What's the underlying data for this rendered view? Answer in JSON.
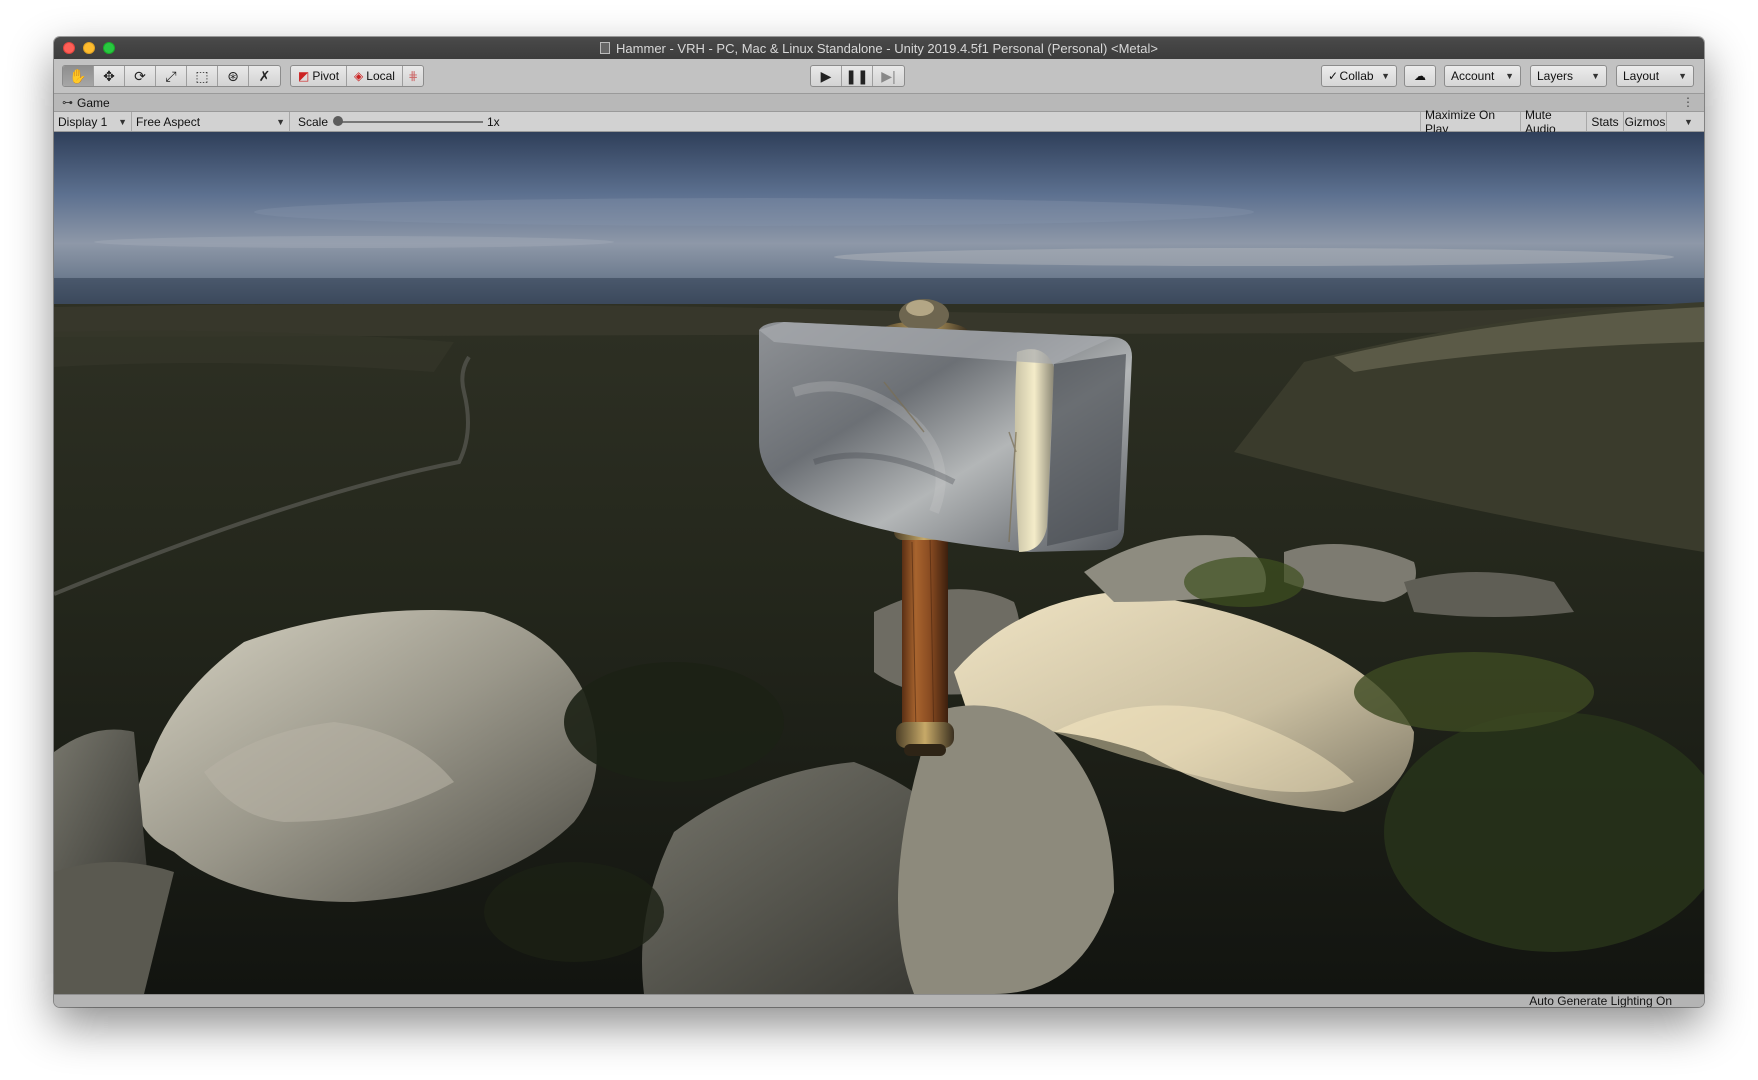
{
  "window": {
    "title": "Hammer - VRH - PC, Mac & Linux Standalone - Unity 2019.4.5f1 Personal (Personal) <Metal>"
  },
  "toolbar": {
    "tools": [
      "hand-tool",
      "move-tool",
      "rotate-tool",
      "scale-tool",
      "rect-tool",
      "transform-tool",
      "custom-tool"
    ],
    "pivot_label": "Pivot",
    "local_label": "Local",
    "collab_label": "Collab",
    "account_label": "Account",
    "layers_label": "Layers",
    "layout_label": "Layout"
  },
  "game_view": {
    "tab_label": "Game",
    "display_label": "Display 1",
    "aspect_label": "Free Aspect",
    "scale_label": "Scale",
    "scale_value": "1x",
    "maximize_label": "Maximize On Play",
    "mute_label": "Mute Audio",
    "stats_label": "Stats",
    "gizmos_label": "Gizmos"
  },
  "status_bar": {
    "text": "Auto Generate Lighting On"
  },
  "colors": {
    "titlebar": "#3c3c3c",
    "toolbar": "#c2c2c2",
    "sky_top": "#3a4d6a",
    "ground": "#1d2117"
  }
}
